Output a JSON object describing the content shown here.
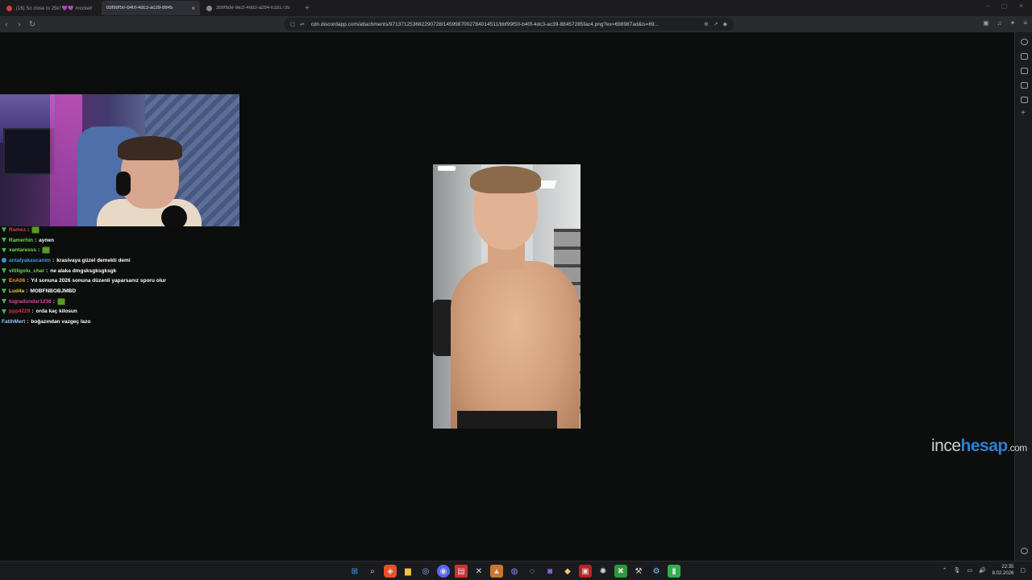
{
  "browser": {
    "tabs": [
      {
        "title": "(16) So close to 25k! 💜💜 #rocket!"
      },
      {
        "title": "bbf99f50-b40f-4dc3-ac39-8845"
      },
      {
        "title": "3b9f6de-9e2f-48d3-a2b4-b1b1735"
      }
    ],
    "close_tab": "×",
    "new_tab": "+",
    "url": "cdn.discordapp.com/attachments/971371253682290728/1459987002784014511/bbf99f50-b40f-4dc3-ac39-88457285fac4.png?ex=698987ad&is=69..."
  },
  "chat": [
    {
      "user": "Ramez",
      "color": "#d9443a",
      "badge": "green",
      "text": "",
      "emote": true
    },
    {
      "user": "Ramerhin",
      "color": "#6ddc4e",
      "badge": "green",
      "text": "aynen",
      "emote": false
    },
    {
      "user": "xantaresss",
      "color": "#6ddc4e",
      "badge": "green",
      "text": "",
      "emote": true
    },
    {
      "user": "antalyakascanim",
      "color": "#3a9fe0",
      "badge": "blue",
      "text": "krasivaya güzel demekti demi",
      "emote": false
    },
    {
      "user": "vitiligolu_char",
      "color": "#6ddc4e",
      "badge": "green",
      "text": "ne alaka dmgsksgksgksgk",
      "emote": false
    },
    {
      "user": "EnA06",
      "color": "#f0923a",
      "badge": "green",
      "text": "Yıl sonuna 2026 sonuna düzenli yaparsanız sporu olur",
      "emote": false
    },
    {
      "user": "Lud4a",
      "color": "#e5d23a",
      "badge": "green",
      "text": "MOBFNBOBJMBD",
      "emote": false
    },
    {
      "user": "tugradundar1238",
      "color": "#e0449a",
      "badge": "green",
      "text": "",
      "emote": true
    },
    {
      "user": "ppp4229",
      "color": "#d92f4a",
      "badge": "green",
      "text": "orda kaç kilosun",
      "emote": false
    },
    {
      "user": "FatihMert",
      "color": "#9ec6f0",
      "badge": "none",
      "text": "boğazından vazgeç lazo",
      "emote": false
    }
  ],
  "watermark": {
    "part1": "ince",
    "part2": "hesap",
    "part3": ".com"
  },
  "taskbar": {
    "time": "22:35",
    "date": "8.02.2026"
  }
}
